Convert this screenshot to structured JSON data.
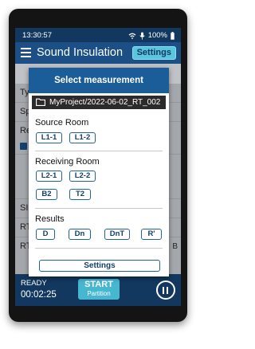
{
  "status_bar": {
    "time": "13:30:57",
    "battery": "100%"
  },
  "app_bar": {
    "title": "Sound Insulation",
    "settings_label": "Settings"
  },
  "background": {
    "rows": [
      "Ty",
      "Sp",
      "Re",
      "SI",
      "RT",
      "RT"
    ],
    "right_letter": "B"
  },
  "dialog": {
    "title": "Select measurement",
    "folder_path": "MyProject/2022-06-02_RT_002",
    "source_room": {
      "label": "Source Room",
      "items": [
        "L1-1",
        "L1-2"
      ]
    },
    "receiving_room": {
      "label": "Receiving Room",
      "items": [
        "L2-1",
        "L2-2",
        "B2",
        "T2"
      ]
    },
    "results": {
      "label": "Results",
      "items": [
        "D",
        "Dn",
        "DnT",
        "R'"
      ]
    },
    "settings_button": "Settings"
  },
  "bottom_bar": {
    "status": "READY",
    "timer": "00:02:25",
    "start_label": "START",
    "start_sub": "Partition"
  },
  "colors": {
    "status_bar": "#12385f",
    "app_bar": "#1b4f86",
    "dialog_header": "#1b5d98",
    "accent": "#47b7cf"
  }
}
